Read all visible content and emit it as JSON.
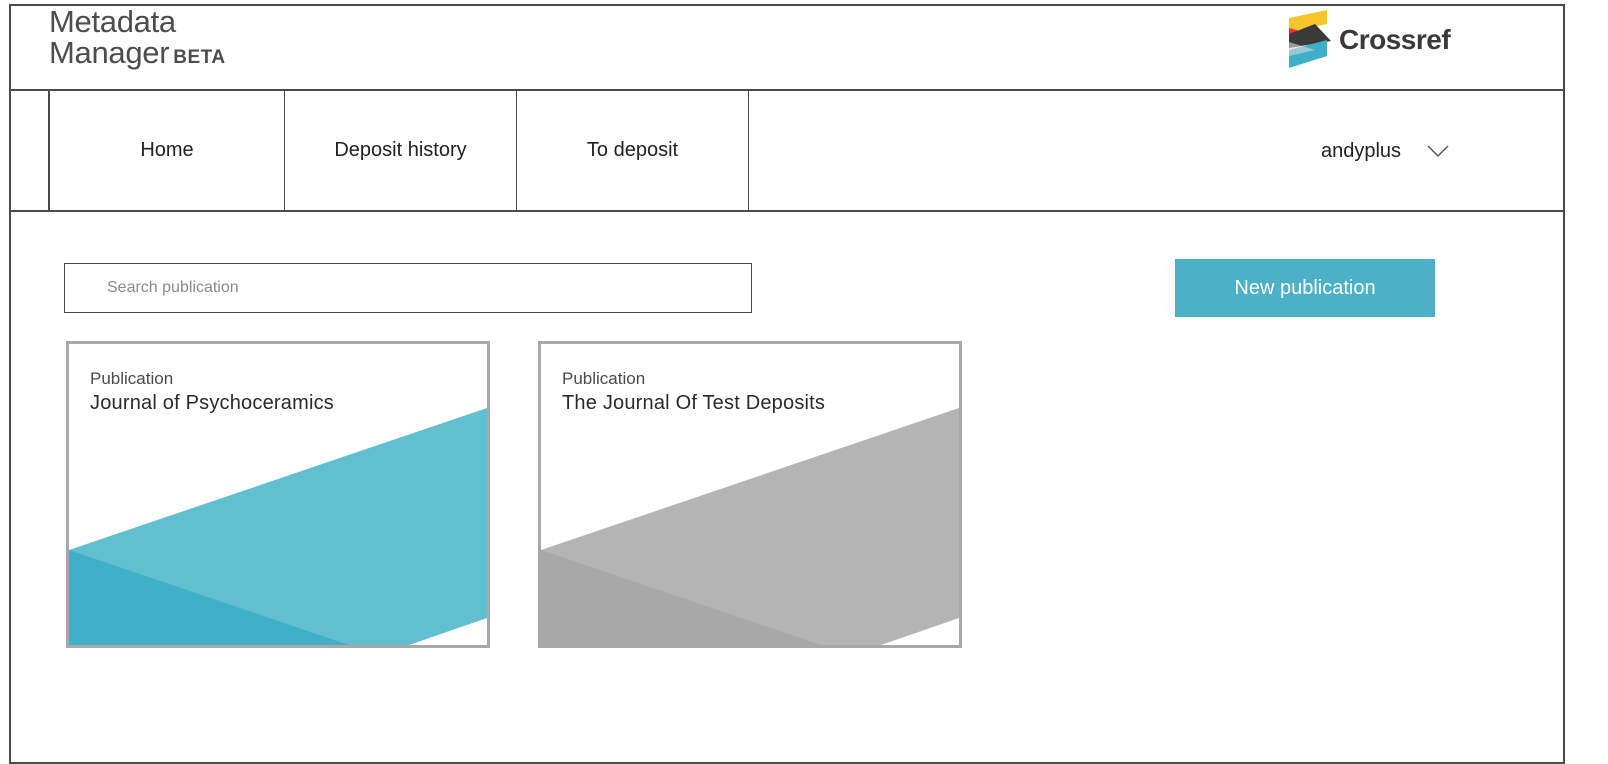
{
  "header": {
    "app_title_line1": "Metadata",
    "app_title_line2": "Manager",
    "app_badge": "BETA",
    "brand_name": "Crossref",
    "logo_icon": "crossref-logo-icon"
  },
  "nav": {
    "tabs": [
      {
        "label": "Home"
      },
      {
        "label": "Deposit history"
      },
      {
        "label": "To deposit"
      }
    ],
    "user": {
      "name": "andyplus",
      "icon": "chevron-down-icon"
    }
  },
  "search": {
    "placeholder": "Search publication",
    "value": ""
  },
  "actions": {
    "new_publication_label": "New publication"
  },
  "publications": [
    {
      "kind": "Publication",
      "title": "Journal of Psychoceramics",
      "accent_light": "#62bfd0",
      "accent_dark": "#3fb0c8"
    },
    {
      "kind": "Publication",
      "title": "The Journal Of Test Deposits",
      "accent_light": "#b4b4b4",
      "accent_dark": "#a8a8a8"
    }
  ],
  "colors": {
    "accent": "#4cb1c8",
    "border": "#4a4a4a",
    "logo_yellow": "#f6c52a",
    "logo_red": "#ee2d45",
    "logo_teal": "#3eb1c8",
    "logo_dark": "#3a3a3a"
  }
}
